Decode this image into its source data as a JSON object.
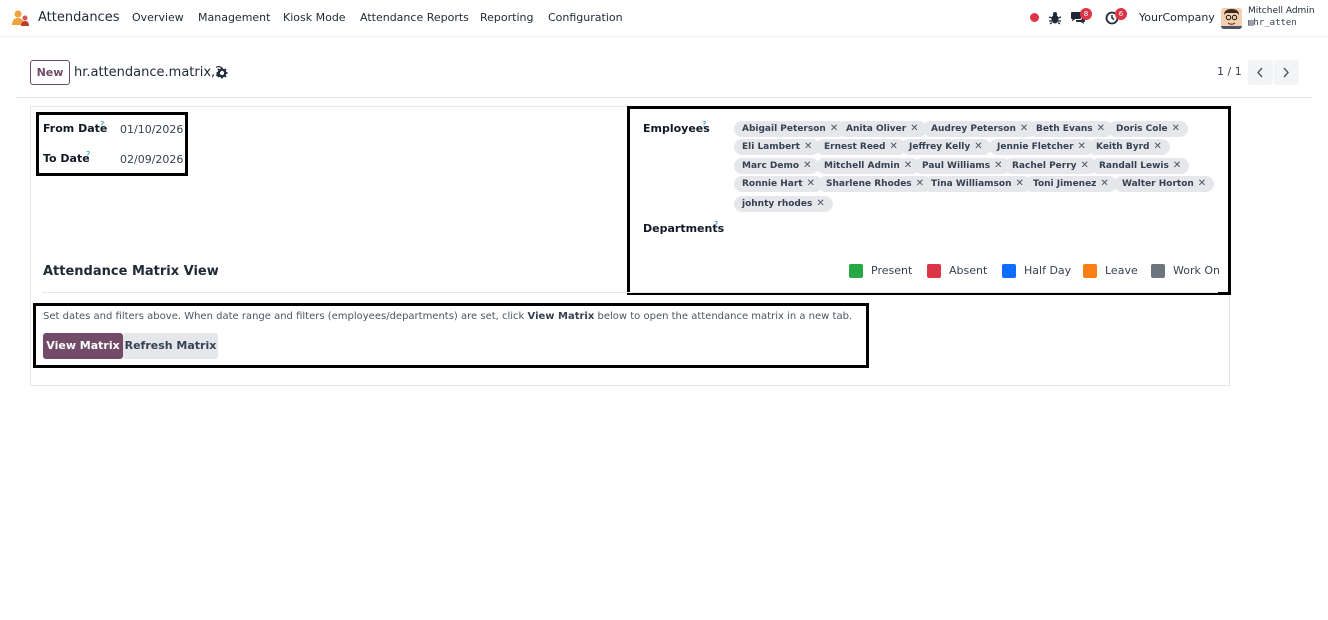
{
  "navbar": {
    "app_name": "Attendances",
    "menu": [
      "Overview",
      "Management",
      "Kiosk Mode",
      "Attendance Reports",
      "Reporting",
      "Configuration"
    ],
    "chat_badge": "8",
    "activity_badge": "6",
    "company": "YourCompany",
    "user_name": "Mitchell Admin",
    "db_name": "hr_atten"
  },
  "control_panel": {
    "new_label": "New",
    "record_title": "hr.attendance.matrix,2",
    "pager": "1 / 1"
  },
  "form": {
    "from_date_label": "From Date",
    "from_date_value": "01/10/2026",
    "to_date_label": "To Date",
    "to_date_value": "02/09/2026",
    "help_mark": "?",
    "employees_label": "Employees",
    "employees": [
      "Abigail Peterson",
      "Anita Oliver",
      "Audrey Peterson",
      "Beth Evans",
      "Doris Cole",
      "Eli Lambert",
      "Ernest Reed",
      "Jeffrey Kelly",
      "Jennie Fletcher",
      "Keith Byrd",
      "Marc Demo",
      "Mitchell Admin",
      "Paul Williams",
      "Rachel Perry",
      "Randall Lewis",
      "Ronnie Hart",
      "Sharlene Rhodes",
      "Tina Williamson",
      "Toni Jimenez",
      "Walter Horton",
      "johnty rhodes"
    ],
    "tag_remove": "✕",
    "departments_label": "Departments",
    "legend": [
      {
        "label": "Present",
        "color": "#28a745"
      },
      {
        "label": "Absent",
        "color": "#dc3545"
      },
      {
        "label": "Half Day",
        "color": "#0d6efd"
      },
      {
        "label": "Leave",
        "color": "#fd7e14"
      },
      {
        "label": "Work On",
        "color": "#6c757d"
      }
    ],
    "section_title": "Attendance Matrix View",
    "instructions_pre": "Set dates and filters above. When date range and filters (employees/departments) are set, click ",
    "instructions_bold": "View Matrix",
    "instructions_post": " below to open the attendance matrix in a new tab.",
    "view_matrix_label": "View Matrix",
    "refresh_matrix_label": "Refresh Matrix"
  }
}
